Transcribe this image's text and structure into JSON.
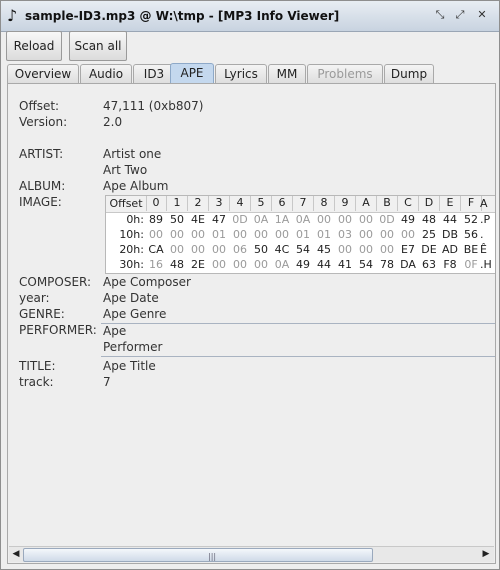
{
  "window": {
    "icon": "music-note-icon",
    "title": "sample-ID3.mp3 @ W:\\tmp - [MP3 Info Viewer]"
  },
  "toolbar": {
    "reload_label": "Reload",
    "scan_all_label": "Scan all"
  },
  "tabs": [
    {
      "label": "Overview",
      "state": "normal"
    },
    {
      "label": "Audio",
      "state": "normal"
    },
    {
      "label": "ID3",
      "state": "normal"
    },
    {
      "label": "APE",
      "state": "active"
    },
    {
      "label": "Lyrics",
      "state": "normal"
    },
    {
      "label": "MM",
      "state": "normal"
    },
    {
      "label": "Problems",
      "state": "disabled"
    },
    {
      "label": "Dump",
      "state": "normal"
    }
  ],
  "fields": {
    "offset_label": "Offset:",
    "offset_value": "47,111 (0xb807)",
    "version_label": "Version:",
    "version_value": "2.0",
    "artist_label": "ARTIST:",
    "artist_value_1": "Artist one",
    "artist_value_2": "Art Two",
    "album_label": "ALBUM:",
    "album_value": "Ape Album",
    "image_label": "IMAGE:",
    "composer_label": "COMPOSER:",
    "composer_value": "Ape Composer",
    "year_label": "year:",
    "year_value": "Ape Date",
    "genre_label": "GENRE:",
    "genre_value": "Ape Genre",
    "performer_label": "PERFORMER:",
    "performer_value_1": "Ape",
    "performer_value_2": "Performer",
    "title_label": "TITLE:",
    "title_value": "Ape Title",
    "track_label": "track:",
    "track_value": "7"
  },
  "hex_table": {
    "offset_header": "Offset",
    "columns": [
      "0",
      "1",
      "2",
      "3",
      "4",
      "5",
      "6",
      "7",
      "8",
      "9",
      "A",
      "B",
      "C",
      "D",
      "E",
      "F"
    ],
    "ascii_header": "A",
    "rows": [
      {
        "offset": "0h:",
        "bytes": [
          "89",
          "50",
          "4E",
          "47",
          "0D",
          "0A",
          "1A",
          "0A",
          "00",
          "00",
          "00",
          "0D",
          "49",
          "48",
          "44",
          "52"
        ],
        "ascii": ".P"
      },
      {
        "offset": "10h:",
        "bytes": [
          "00",
          "00",
          "00",
          "01",
          "00",
          "00",
          "00",
          "01",
          "01",
          "03",
          "00",
          "00",
          "00",
          "25",
          "DB",
          "56"
        ],
        "ascii": "."
      },
      {
        "offset": "20h:",
        "bytes": [
          "CA",
          "00",
          "00",
          "00",
          "06",
          "50",
          "4C",
          "54",
          "45",
          "00",
          "00",
          "00",
          "E7",
          "DE",
          "AD",
          "BE"
        ],
        "ascii": "Ê"
      },
      {
        "offset": "30h:",
        "bytes": [
          "16",
          "48",
          "2E",
          "00",
          "00",
          "00",
          "0A",
          "49",
          "44",
          "41",
          "54",
          "78",
          "DA",
          "63",
          "F8",
          "0F"
        ],
        "ascii": ".H"
      }
    ]
  }
}
